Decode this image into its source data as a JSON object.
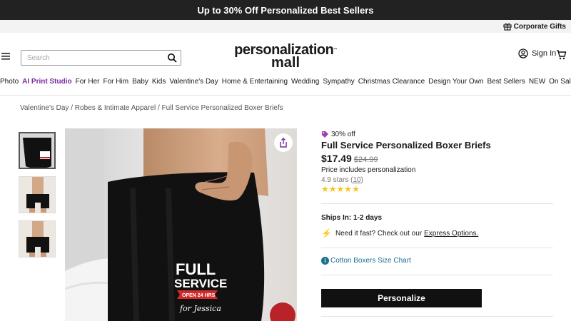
{
  "promo": {
    "text": "Up to 30% Off Personalized Best Sellers"
  },
  "utility": {
    "corporate_gifts": "Corporate Gifts"
  },
  "search": {
    "placeholder": "Search"
  },
  "logo": {
    "line1": "personalization",
    "line2": "mall",
    "tm": "™"
  },
  "account": {
    "sign_in": "Sign In"
  },
  "nav": {
    "items": [
      "Photo",
      "AI Print Studio",
      "For Her",
      "For Him",
      "Baby",
      "Kids",
      "Valentine's Day",
      "Home & Entertaining",
      "Wedding",
      "Sympathy",
      "Christmas Clearance",
      "Design Your Own",
      "Best Sellers",
      "NEW",
      "On Sale"
    ]
  },
  "breadcrumb": {
    "items": [
      "Valentine's Day",
      "Robes & Intimate Apparel",
      "Full Service Personalized Boxer Briefs"
    ],
    "separator": "/"
  },
  "product": {
    "discount": "30% off",
    "title": "Full Service Personalized Boxer Briefs",
    "price": "$17.49",
    "original_price": "$24.99",
    "price_note": "Price includes personalization",
    "rating_prefix": "4.9 stars (",
    "rating_count": "10",
    "rating_suffix": ")",
    "stars": 5,
    "ships_in": "Ships In: 1-2 days",
    "need_fast": "Need it fast? Check out our",
    "express_link": "Express Options.",
    "size_chart": "Cotton Boxers Size Chart",
    "personalize_button": "Personalize",
    "print": {
      "line1": "FULL",
      "line2": "SERVICE",
      "banner": "OPEN 24 HRS",
      "script": "for Jessica"
    }
  },
  "colors": {
    "promo_bg": "#222222",
    "accent_purple": "#7a2a9a",
    "link_teal": "#1a6f8f",
    "star": "#f5c518"
  }
}
